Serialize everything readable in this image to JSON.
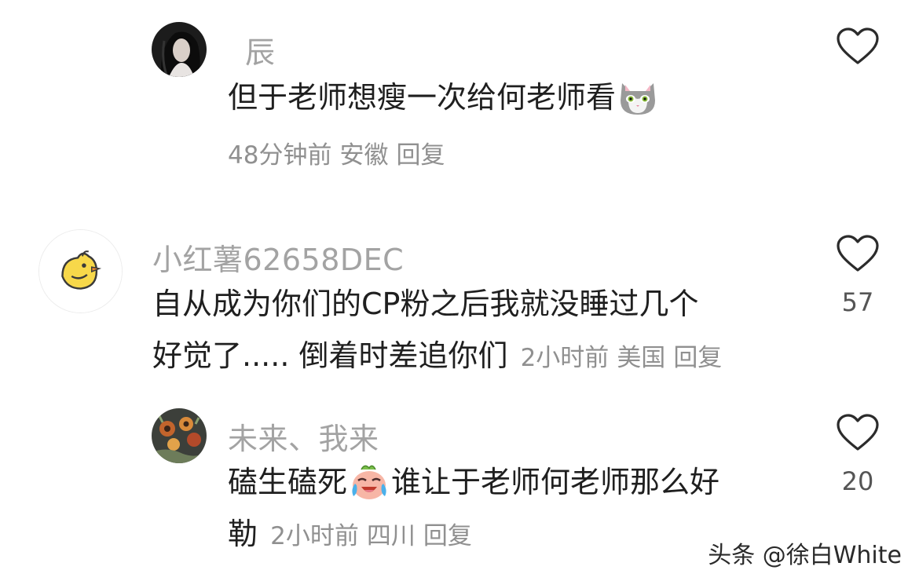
{
  "comments": [
    {
      "username": "辰",
      "text_part1": "但于老师想瘦一次给何老师看",
      "emoji": "cat-face-emoji",
      "time": "48分钟前",
      "location": "安徽",
      "reply_label": "回复",
      "like_count": ""
    },
    {
      "username": "小红薯62658DEC",
      "text_line1": "自从成为你们的CP粉之后我就没睡过几个",
      "text_line2": "好觉了..... 倒着时差追你们",
      "time": "2小时前",
      "location": "美国",
      "reply_label": "回复",
      "like_count": "57"
    },
    {
      "username": "未来、我来",
      "text_part1": "磕生磕死",
      "emoji": "crying-laughing-emoji",
      "text_part2": "谁让于老师何老师那么好",
      "text_line2": "勒",
      "time": "2小时前",
      "location": "四川",
      "reply_label": "回复",
      "like_count": "20"
    }
  ],
  "watermark": "头条 @徐白White",
  "colors": {
    "username": "#a3a3a3",
    "text": "#1f1f1f",
    "meta": "#909090",
    "like_outline": "#2b2b2b"
  }
}
